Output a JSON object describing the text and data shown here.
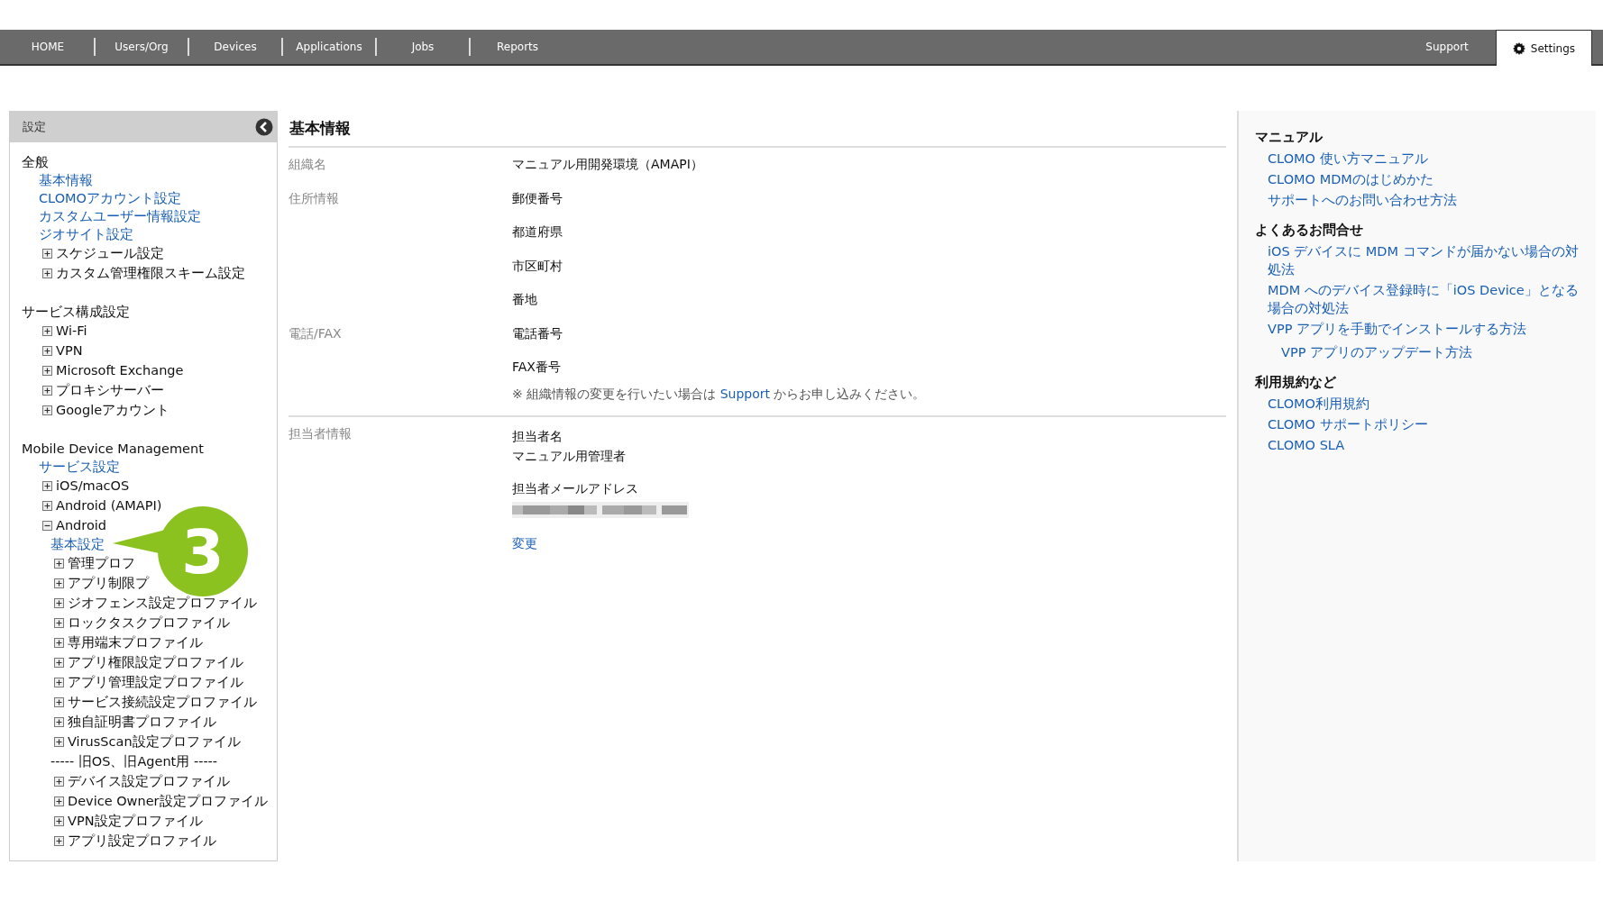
{
  "nav": {
    "items": [
      {
        "label": "HOME",
        "selected": false
      },
      {
        "label": "Users/Org",
        "selected": false
      },
      {
        "label": "Devices",
        "selected": false
      },
      {
        "label": "Applications",
        "selected": false
      },
      {
        "label": "Jobs",
        "selected": false
      },
      {
        "label": "Reports",
        "selected": false
      }
    ],
    "right_items": [
      {
        "label": "Support",
        "selected": false
      },
      {
        "label": "Settings",
        "selected": true
      }
    ]
  },
  "sidebar": {
    "title": "設定",
    "sections": [
      {
        "title": "全般",
        "items": [
          {
            "kind": "link",
            "label": "基本情報"
          },
          {
            "kind": "link",
            "label": "CLOMOアカウント設定"
          },
          {
            "kind": "link",
            "label": "カスタムユーザー情報設定"
          },
          {
            "kind": "link",
            "label": "ジオサイト設定"
          },
          {
            "kind": "folder",
            "label": "スケジュール設定",
            "expanded": false
          },
          {
            "kind": "folder",
            "label": "カスタム管理権限スキーム設定",
            "expanded": false
          }
        ]
      },
      {
        "title": "サービス構成設定",
        "items": [
          {
            "kind": "folder",
            "label": "Wi-Fi",
            "expanded": false
          },
          {
            "kind": "folder",
            "label": "VPN",
            "expanded": false
          },
          {
            "kind": "folder",
            "label": "Microsoft Exchange",
            "expanded": false
          },
          {
            "kind": "folder",
            "label": "プロキシサーバー",
            "expanded": false
          },
          {
            "kind": "folder",
            "label": "Googleアカウント",
            "expanded": false
          }
        ]
      },
      {
        "title": "Mobile Device Management",
        "items": [
          {
            "kind": "link",
            "label": "サービス設定"
          },
          {
            "kind": "folder",
            "label": "iOS/macOS",
            "expanded": false
          },
          {
            "kind": "folder",
            "label": "Android (AMAPI)",
            "expanded": false
          },
          {
            "kind": "folder",
            "label": "Android",
            "expanded": true,
            "children": [
              {
                "kind": "link",
                "label": "基本設定"
              },
              {
                "kind": "folder",
                "label": "管理プロフ",
                "expanded": false
              },
              {
                "kind": "folder",
                "label": "アプリ制限プ",
                "expanded": false
              },
              {
                "kind": "folder",
                "label": "ジオフェンス設定プロファイル",
                "expanded": false
              },
              {
                "kind": "folder",
                "label": "ロックタスクプロファイル",
                "expanded": false
              },
              {
                "kind": "folder",
                "label": "専用端末プロファイル",
                "expanded": false
              },
              {
                "kind": "folder",
                "label": "アプリ権限設定プロファイル",
                "expanded": false
              },
              {
                "kind": "folder",
                "label": "アプリ管理設定プロファイル",
                "expanded": false
              },
              {
                "kind": "folder",
                "label": "サービス接続設定プロファイル",
                "expanded": false
              },
              {
                "kind": "folder",
                "label": "独自証明書プロファイル",
                "expanded": false
              },
              {
                "kind": "folder",
                "label": "VirusScan設定プロファイル",
                "expanded": false
              },
              {
                "kind": "separator",
                "label": "----- 旧OS、旧Agent用 -----"
              },
              {
                "kind": "folder",
                "label": "デバイス設定プロファイル",
                "expanded": false
              },
              {
                "kind": "folder",
                "label": "Device Owner設定プロファイル",
                "expanded": false
              },
              {
                "kind": "folder",
                "label": "VPN設定プロファイル",
                "expanded": false
              },
              {
                "kind": "folder",
                "label": "アプリ設定プロファイル",
                "expanded": false
              }
            ]
          }
        ]
      }
    ]
  },
  "callout": {
    "label": "3"
  },
  "main": {
    "title": "基本情報",
    "org_rows": [
      {
        "label": "組織名",
        "values": [
          "マニュアル用開発環境（AMAPI）"
        ]
      },
      {
        "label": "住所情報",
        "values": [
          "郵便番号",
          "都道府県",
          "市区町村",
          "番地"
        ]
      },
      {
        "label": "電話/FAX",
        "values": [
          "電話番号",
          "FAX番号"
        ]
      }
    ],
    "note": {
      "before": "※ 組織情報の変更を行いたい場合は",
      "link": "Support",
      "after": "からお申し込みください。"
    },
    "contact": {
      "label": "担当者情報",
      "name_label": "担当者名",
      "name_value": "マニュアル用管理者",
      "email_label": "担当者メールアドレス",
      "email_redacted": true,
      "edit_link": "変更"
    }
  },
  "help": {
    "sections": [
      {
        "title": "マニュアル",
        "links": [
          {
            "label": "CLOMO 使い方マニュアル"
          },
          {
            "label": "CLOMO MDMのはじめかた"
          },
          {
            "label": "サポートへのお問い合わせ方法"
          }
        ]
      },
      {
        "title": "よくあるお問合せ",
        "links": [
          {
            "label": "iOS デバイスに MDM コマンドが届かない場合の対処法"
          },
          {
            "label": "MDM へのデバイス登録時に「iOS Device」となる場合の対処法"
          },
          {
            "label": "VPP アプリを手動でインストールする方法",
            "children": [
              {
                "label": "VPP アプリのアップデート方法"
              }
            ]
          }
        ]
      },
      {
        "title": "利用規約など",
        "links": [
          {
            "label": "CLOMO利用規約"
          },
          {
            "label": "CLOMO サポートポリシー"
          },
          {
            "label": "CLOMO SLA"
          }
        ]
      }
    ]
  }
}
